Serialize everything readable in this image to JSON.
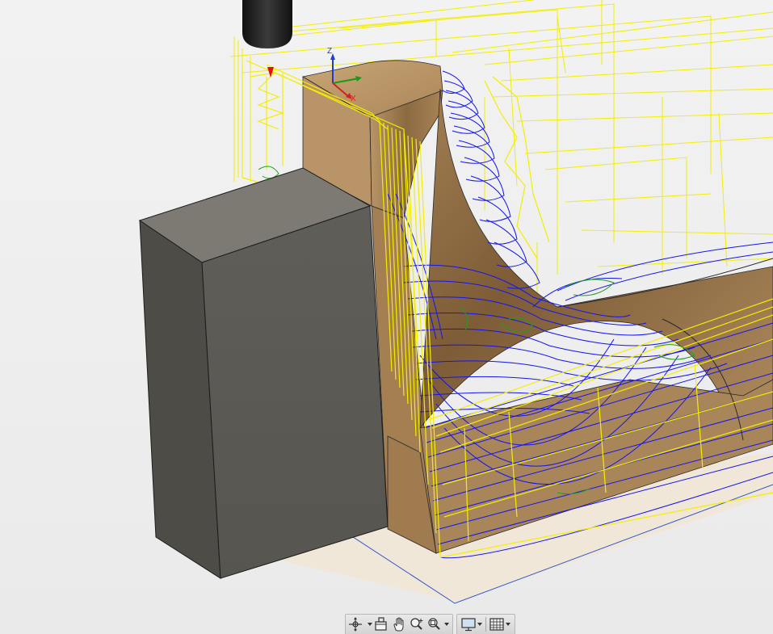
{
  "viewport": {
    "axis_labels": {
      "z": "Z",
      "x": "X"
    },
    "colors": {
      "background": "#efefef",
      "toolpath_yellow": "#f4f000",
      "toolpath_blue": "#1a1aff",
      "toolpath_green": "#22aa22",
      "wood": "#9c7a4e",
      "fixture_block": "#5f5d56",
      "tool_holder": "#1c1c1c",
      "setup_plane": "#2050c8"
    }
  },
  "navigation_toolbar": {
    "groups": [
      {
        "buttons": [
          "orbit-icon",
          "look-at-icon",
          "pan-icon",
          "zoom-icon",
          "fit-icon"
        ]
      },
      {
        "buttons": [
          "display-settings-icon",
          "grid-settings-icon"
        ]
      }
    ]
  }
}
